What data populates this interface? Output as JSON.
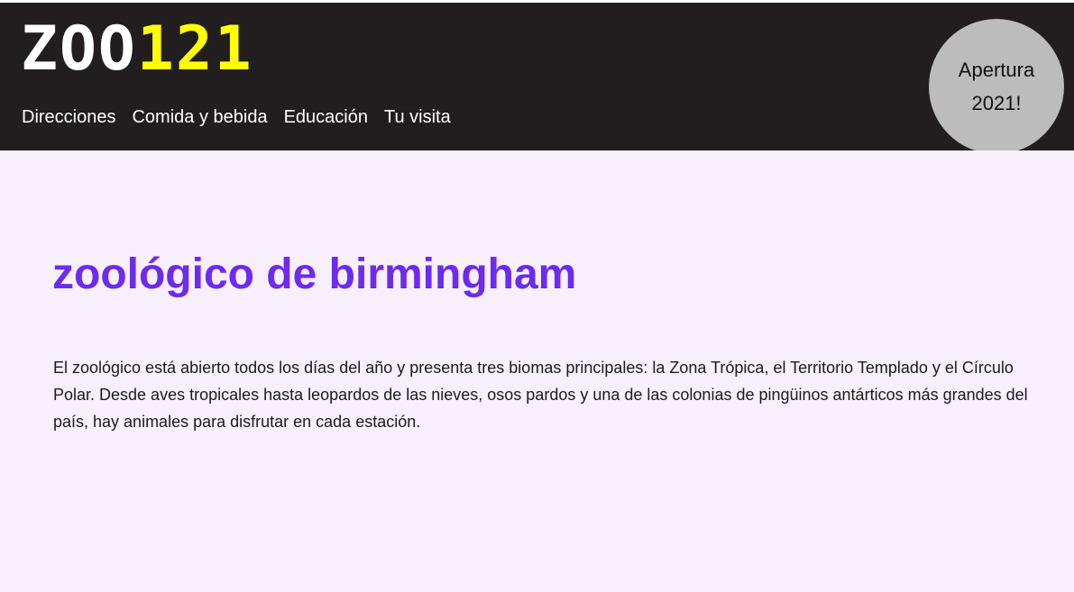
{
  "header": {
    "logo": {
      "part1": "ZOO",
      "part2": "121"
    },
    "nav": [
      {
        "label": "Direcciones"
      },
      {
        "label": "Comida y bebida"
      },
      {
        "label": "Educación"
      },
      {
        "label": "Tu visita"
      }
    ],
    "badge": {
      "line1": "Apertura",
      "line2": "2021!"
    }
  },
  "main": {
    "title": "zoológico de birmingham",
    "intro": "El zoológico está abierto todos los días del año y presenta tres biomas principales: la Zona Trópica, el Territorio Templado y el Círculo Polar. Desde aves tropicales hasta leopardos de las nieves, osos pardos y una de las colonias de pingüinos antárticos más grandes del país, hay animales para disfrutar en cada estación."
  },
  "colors": {
    "header_background": "#221e1f",
    "logo_primary": "#ffffff",
    "logo_accent": "#ffff00",
    "badge_background": "#bcbcbc",
    "page_background": "#f7effc",
    "title": "#6c2bef"
  }
}
